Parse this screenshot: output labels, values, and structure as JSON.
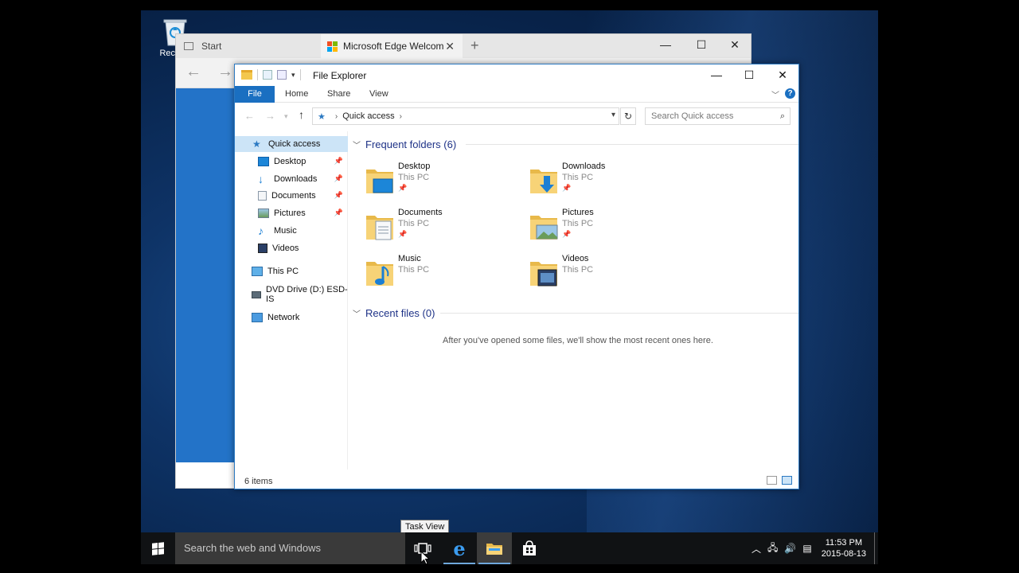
{
  "desktop": {
    "recycle_bin_label": "Recycle"
  },
  "edge": {
    "tabs": [
      {
        "label": "Start"
      },
      {
        "label": "Microsoft Edge Welcom"
      }
    ],
    "new_tab_glyph": "+",
    "close_tab_glyph": "✕",
    "ms_logo_colors": [
      "#f25022",
      "#7fba00",
      "#00a4ef",
      "#ffb900"
    ],
    "accent": "#2373c8"
  },
  "explorer": {
    "title": "File Explorer",
    "ribbon": {
      "file": "File",
      "tabs": [
        "Home",
        "Share",
        "View"
      ],
      "help_glyph": "?"
    },
    "address": {
      "crumb": "Quick access",
      "search_placeholder": "Search Quick access"
    },
    "nav": {
      "quick_access": "Quick access",
      "pinned": [
        {
          "label": "Desktop",
          "icon": "desktop-icon"
        },
        {
          "label": "Downloads",
          "icon": "downloads-icon"
        },
        {
          "label": "Documents",
          "icon": "documents-icon"
        },
        {
          "label": "Pictures",
          "icon": "pictures-icon"
        },
        {
          "label": "Music",
          "icon": "music-icon"
        },
        {
          "label": "Videos",
          "icon": "videos-icon"
        }
      ],
      "this_pc": "This PC",
      "dvd": "DVD Drive (D:) ESD-IS",
      "network": "Network"
    },
    "frequent": {
      "header": "Frequent folders (6)",
      "folders": [
        {
          "name": "Desktop",
          "location": "This PC",
          "icon": "desktop-folder-icon"
        },
        {
          "name": "Downloads",
          "location": "This PC",
          "icon": "downloads-folder-icon"
        },
        {
          "name": "Documents",
          "location": "This PC",
          "icon": "documents-folder-icon"
        },
        {
          "name": "Pictures",
          "location": "This PC",
          "icon": "pictures-folder-icon"
        },
        {
          "name": "Music",
          "location": "This PC",
          "icon": "music-folder-icon"
        },
        {
          "name": "Videos",
          "location": "This PC",
          "icon": "videos-folder-icon"
        }
      ]
    },
    "recent": {
      "header": "Recent files (0)",
      "empty_message": "After you've opened some files, we'll show the most recent ones here."
    },
    "status": "6 items",
    "accent": "#1a6fc1",
    "selection": "#cce4f7"
  },
  "tooltip": "Task View",
  "taskbar": {
    "search_placeholder": "Search the web and Windows",
    "time": "11:53 PM",
    "date": "2015-08-13"
  }
}
